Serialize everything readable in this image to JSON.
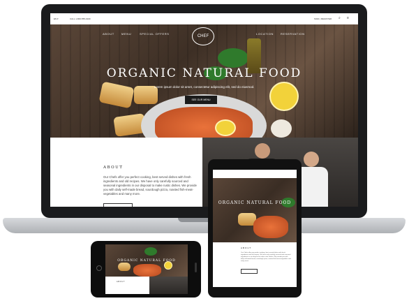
{
  "topbar": {
    "left": "EN ▾",
    "contact": "CALL 1-800-555-0100",
    "right": "SIGN | REGISTER",
    "search_icon": "search-icon",
    "menu_icon": "hamburger-icon"
  },
  "nav": {
    "items": [
      "ABOUT",
      "MENU",
      "SPECIAL OFFERS",
      "LOCATION",
      "RESERVATION"
    ],
    "logo": "CHEF"
  },
  "hero": {
    "title": "ORGANIC NATURAL FOOD",
    "subtitle": "Lorem ipsum dolor sit amet, consectetur adipiscing elit, sed do eiusmod.",
    "button": "SEE OUR MENU"
  },
  "about": {
    "heading": "ABOUT",
    "body": "Our Chefs offer you perfect cooking, best served dishes with fresh ingredients and old recipes. We have only carefully sourced and seasonal ingredients in our disposal to make rustic dishes. We provide you with daily self-made bread, sourdough pizza, roasted fish-meat-vegetables and many more."
  },
  "tablet": {
    "title": "ORGANIC NATURAL FOOD",
    "about_heading": "ABOUT"
  },
  "phone": {
    "title": "ORGANIC NATURAL FOOD",
    "about_heading": "ABOUT"
  },
  "colors": {
    "laptop_bezel": "#1a1b1d",
    "hero_wood": "#4b3a2e",
    "button": "#1b1b1b",
    "base": "#c7c9cc"
  }
}
